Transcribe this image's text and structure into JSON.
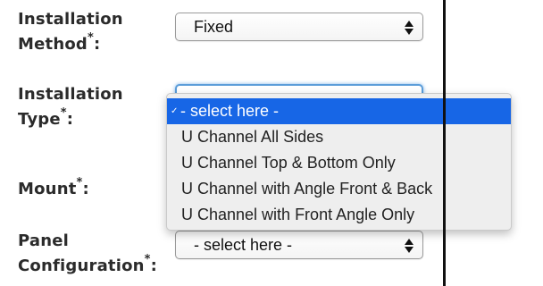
{
  "form": {
    "fields": [
      {
        "label": "Installation",
        "label2": "Method",
        "required_mark": "*",
        "suffix": ":"
      },
      {
        "label": "Installation",
        "label2": "Type",
        "required_mark": "*",
        "suffix": ":"
      },
      {
        "label": "Mount",
        "required_mark": "*",
        "suffix": ":"
      },
      {
        "label": "Panel",
        "label2": "Configuration",
        "required_mark": "*",
        "suffix": ":"
      }
    ],
    "installation_method_value": "Fixed",
    "panel_configuration_value": "- select here -"
  },
  "dropdown": {
    "check_glyph": "✓",
    "options": [
      "- select here -",
      "U Channel All Sides",
      "U Channel Top & Bottom Only",
      "U Channel with Angle Front & Back",
      "U Channel with Front Angle Only"
    ],
    "selected_index": 0,
    "highlight_color": "#1766e6"
  }
}
